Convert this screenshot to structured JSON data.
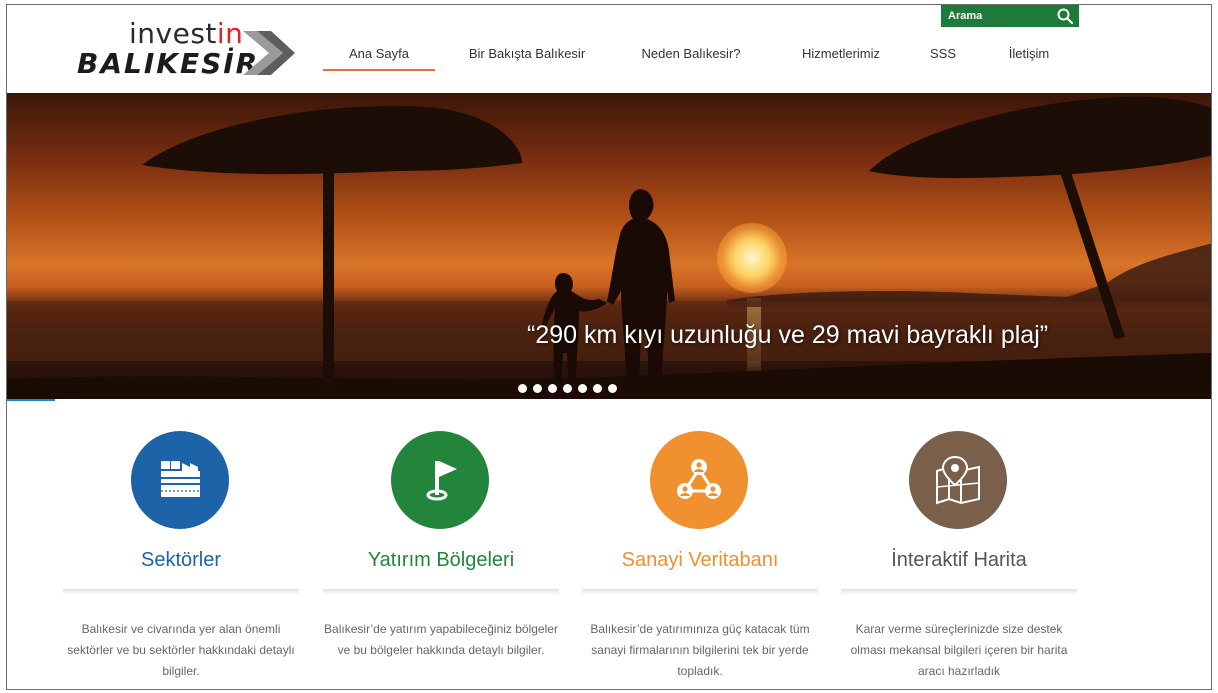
{
  "logo": {
    "line1_a": "invest",
    "line1_b": "in",
    "line2": "BALIKESİR"
  },
  "search": {
    "placeholder": "Arama"
  },
  "nav": {
    "items": [
      {
        "label": "Ana Sayfa"
      },
      {
        "label": "Bir Bakışta Balıkesir"
      },
      {
        "label": "Neden Balıkesir?"
      },
      {
        "label": "Hizmetlerimiz"
      },
      {
        "label": "SSS"
      },
      {
        "label": "İletişim"
      }
    ],
    "active_index": 0
  },
  "hero": {
    "caption": "“290 km kıyı uzunluğu ve 29 mavi bayraklı plaj”",
    "slide_count": 7
  },
  "features": [
    {
      "title": "Sektörler",
      "icon": "factory-icon",
      "color": "#1d63a8",
      "desc": "Balıkesir ve civarında yer alan önemli sektörler ve bu sektörler hakkındaki detaylı bilgiler."
    },
    {
      "title": "Yatırım Bölgeleri",
      "icon": "flag-icon",
      "color": "#23853c",
      "desc": "Balıkesir’de yatırım yapabileceğiniz bölgeler ve bu bölgeler hakkında detaylı bilgiler."
    },
    {
      "title": "Sanayi Veritabanı",
      "icon": "network-users-icon",
      "color": "#f0902f",
      "desc": "Balıkesir’de yatırımınıza güç katacak tüm sanayi firmalarının bilgilerini tek bir yerde topladık."
    },
    {
      "title": "İnteraktif Harita",
      "icon": "map-pin-icon",
      "color": "#7a604b",
      "desc": "Karar verme süreçlerinizde size destek olması  mekansal bilgileri içeren bir harita aracı hazırladık"
    }
  ],
  "colors": {
    "accent_nav": "#e0703a",
    "search_bg": "#1d7a3a",
    "title_sektorler": "#1d63a8",
    "title_yatirim": "#23853c",
    "title_sanayi": "#f0902f",
    "title_harita": "#555555"
  }
}
